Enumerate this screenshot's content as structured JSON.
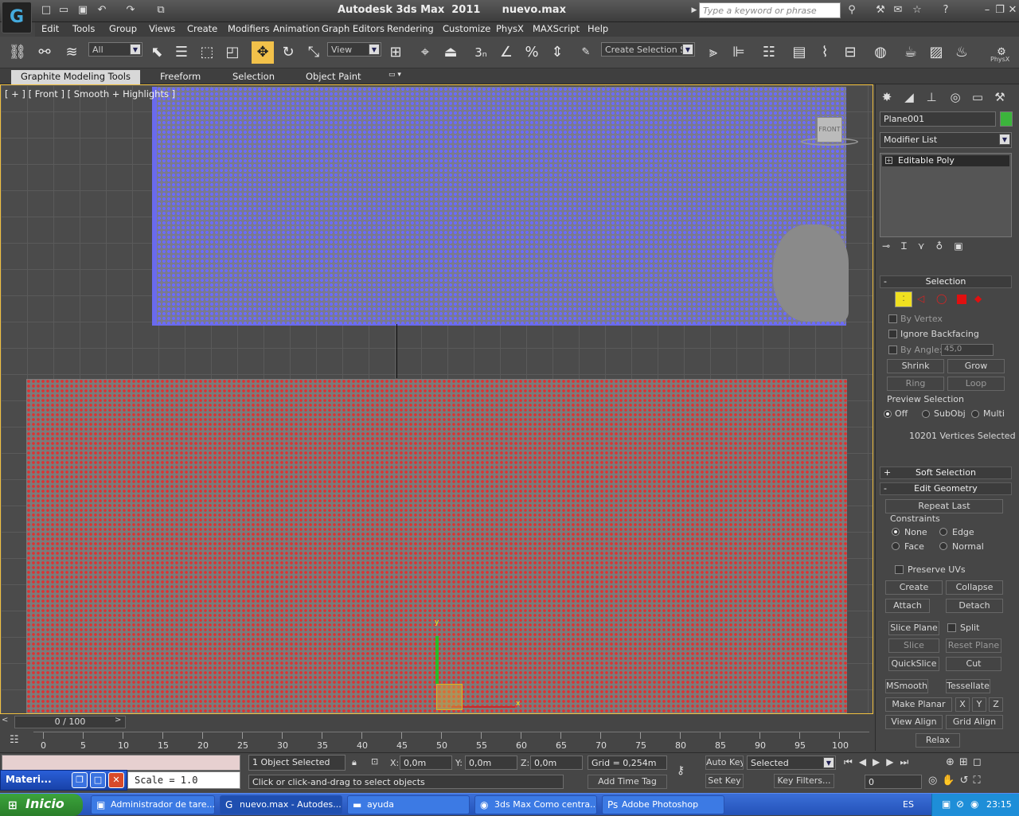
{
  "title_bar": {
    "app_title": "Autodesk 3ds Max  2011",
    "file_name": "nuevo.max",
    "search_placeholder": "Type a keyword or phrase"
  },
  "menu": [
    "Edit",
    "Tools",
    "Group",
    "Views",
    "Create",
    "Modifiers",
    "Animation",
    "Graph Editors",
    "Rendering",
    "Customize",
    "PhysX",
    "MAXScript",
    "Help"
  ],
  "toolbar": {
    "selection_filter": "All",
    "reference_coord": "View",
    "named_selection": "Create Selection Se",
    "physx_label": "PhysX"
  },
  "ribbon": {
    "tabs": [
      "Graphite Modeling Tools",
      "Freeform",
      "Selection",
      "Object Paint"
    ]
  },
  "viewport": {
    "label": "[ + ] [ Front ] [ Smooth + Highlights ]",
    "viewcube_label": "FRONT",
    "gizmo_y": "y",
    "gizmo_x": "x"
  },
  "command_panel": {
    "object_name": "Plane001",
    "object_color": "#3cb43c",
    "modifier_list": "Modifier List",
    "stack_item": "Editable Poly",
    "selection": {
      "title": "Selection",
      "by_vertex": "By Vertex",
      "ignore_backfacing": "Ignore Backfacing",
      "by_angle": "By Angle:",
      "angle_value": "45,0",
      "shrink": "Shrink",
      "grow": "Grow",
      "ring": "Ring",
      "loop": "Loop",
      "preview_selection": "Preview Selection",
      "preview_off": "Off",
      "preview_subobj": "SubObj",
      "preview_multi": "Multi",
      "status": "10201 Vertices Selected"
    },
    "soft_selection": "Soft Selection",
    "edit_geometry": {
      "title": "Edit Geometry",
      "repeat_last": "Repeat Last",
      "constraints": "Constraints",
      "none": "None",
      "edge": "Edge",
      "face": "Face",
      "normal": "Normal",
      "preserve_uvs": "Preserve UVs",
      "create": "Create",
      "collapse": "Collapse",
      "attach": "Attach",
      "detach": "Detach",
      "slice_plane": "Slice Plane",
      "split": "Split",
      "slice": "Slice",
      "reset_plane": "Reset Plane",
      "quickslice": "QuickSlice",
      "cut": "Cut",
      "msmooth": "MSmooth",
      "tessellate": "Tessellate",
      "make_planar": "Make Planar",
      "x": "X",
      "y": "Y",
      "z": "Z",
      "view_align": "View Align",
      "grid_align": "Grid Align",
      "relax": "Relax"
    }
  },
  "timeline": {
    "slider": "0 / 100",
    "ticks": [
      "0",
      "5",
      "10",
      "15",
      "20",
      "25",
      "30",
      "35",
      "40",
      "45",
      "50",
      "55",
      "60",
      "65",
      "70",
      "75",
      "80",
      "85",
      "90",
      "95",
      "100"
    ]
  },
  "status": {
    "selected": "1 Object Selected",
    "prompt": "Click or click-and-drag to select objects",
    "x_label": "X:",
    "x_value": "0,0m",
    "y_label": "Y:",
    "y_value": "0,0m",
    "z_label": "Z:",
    "z_value": "0,0m",
    "grid": "Grid = 0,254m",
    "add_time_tag": "Add Time Tag",
    "auto_key": "Auto Key",
    "set_key": "Set Key",
    "key_mode": "Selected",
    "key_filters": "Key Filters...",
    "frame": "0",
    "scale_text": "Scale = 1.0",
    "materi": "Materi..."
  },
  "taskbar": {
    "start": "Inicio",
    "tasks": [
      "Administrador de tare...",
      "nuevo.max - Autodes...",
      "ayuda",
      "3ds Max Como centra...",
      "Adobe Photoshop"
    ],
    "lang": "ES",
    "clock": "23:15"
  }
}
